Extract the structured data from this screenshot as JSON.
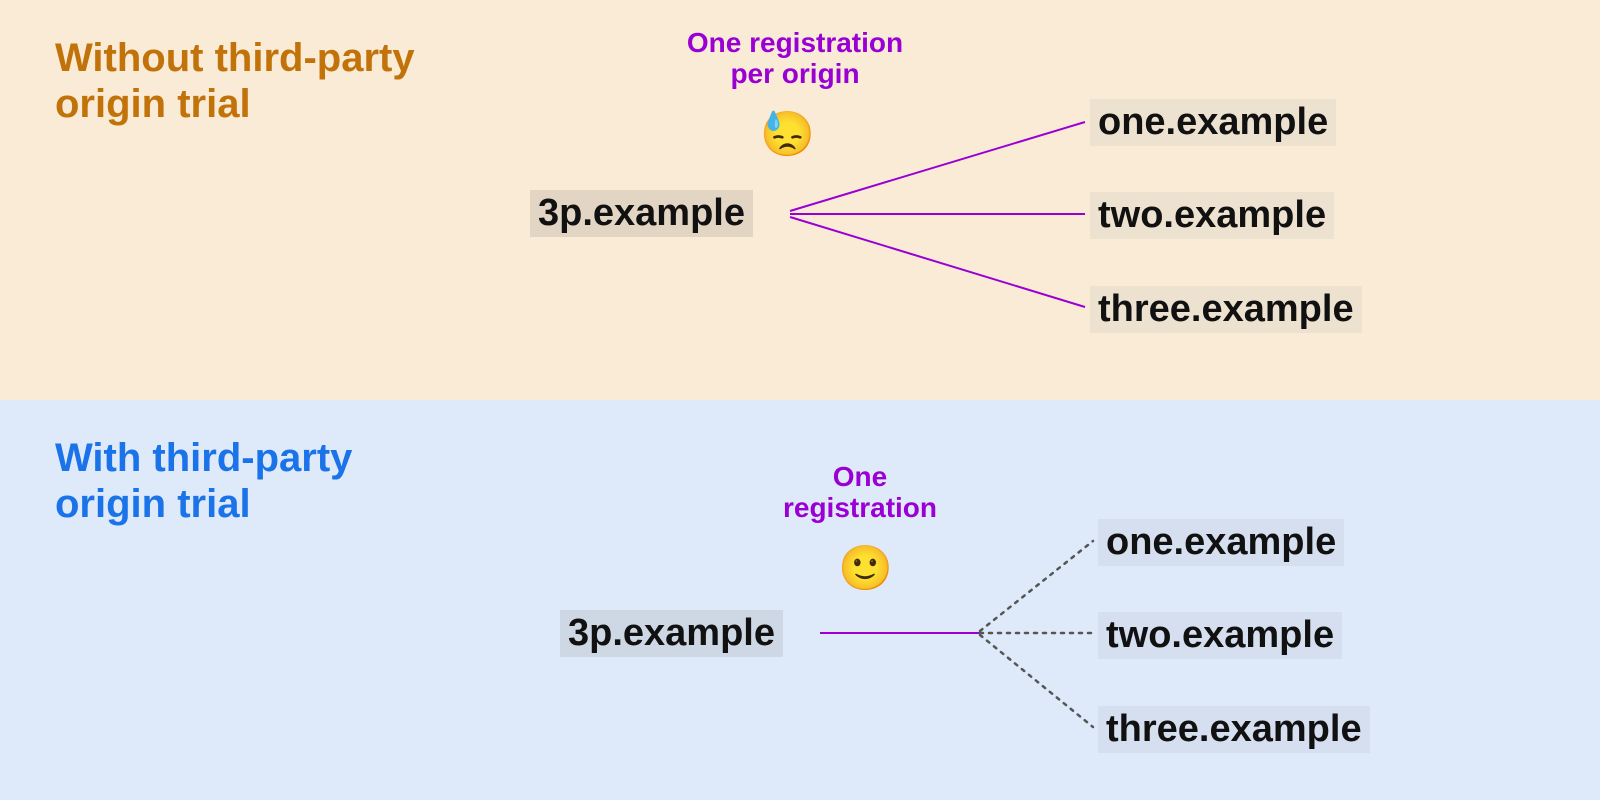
{
  "top": {
    "title_line1": "Without third-party",
    "title_line2": "origin trial",
    "note_line1": "One registration",
    "note_line2": "per origin",
    "emoji": "😓",
    "source": "3p.example",
    "targets": [
      "one.example",
      "two.example",
      "three.example"
    ]
  },
  "bottom": {
    "title_line1": "With third-party",
    "title_line2": "origin trial",
    "note_line1": "One",
    "note_line2": "registration",
    "emoji": "🙂",
    "source": "3p.example",
    "targets": [
      "one.example",
      "two.example",
      "three.example"
    ]
  },
  "colors": {
    "top_bg": "#F9EBD6",
    "bottom_bg": "#DEE9F9",
    "top_title": "#C17209",
    "bottom_title": "#1A73E8",
    "note": "#9A00D4",
    "line_purple": "#9A00D4"
  }
}
